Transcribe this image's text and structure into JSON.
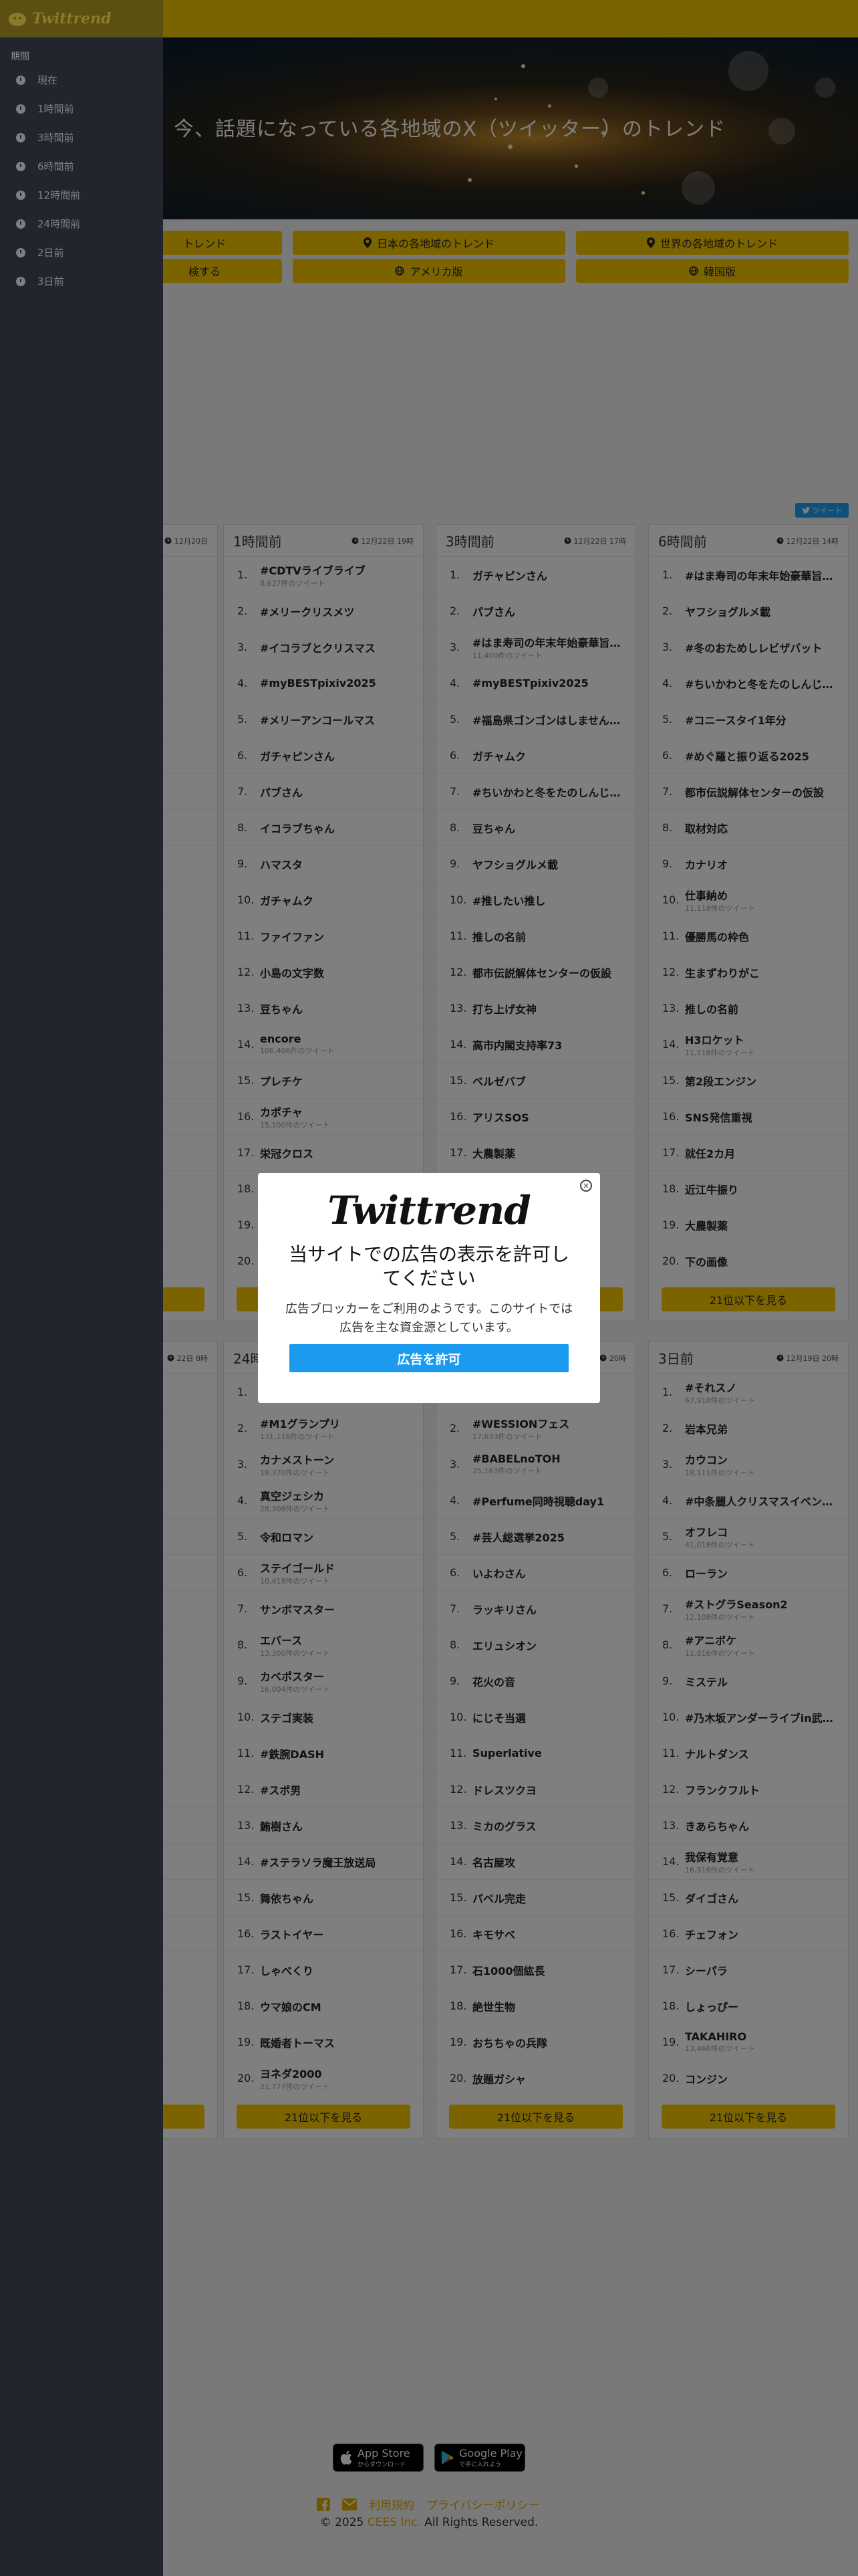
{
  "hero": {
    "title": "今、話題になっている各地域のX（ツイッター）のトレンド"
  },
  "nav": [
    {
      "label": "トレンド",
      "icon": "none"
    },
    {
      "label": "日本の各地域のトレンド",
      "icon": "map-marker-icon"
    },
    {
      "label": "世界の各地域のトレンド",
      "icon": "map-marker-icon"
    },
    {
      "label": "検する",
      "icon": "none"
    },
    {
      "label": "アメリカ版",
      "icon": "globe-icon"
    },
    {
      "label": "韓国版",
      "icon": "globe-icon"
    }
  ],
  "share": {
    "label": "ツイート"
  },
  "cards_top": [
    {
      "title": "",
      "time": "12月20日",
      "partial": true,
      "items": [
        [
          "",
          ""
        ],
        [
          "",
          ""
        ],
        [
          "クス",
          ""
        ],
        [
          "",
          ""
        ],
        [
          "",
          ""
        ],
        [
          "",
          ""
        ],
        [
          "",
          ""
        ],
        [
          "",
          ""
        ],
        [
          "",
          ""
        ],
        [
          "",
          ""
        ],
        [
          "",
          ""
        ],
        [
          "",
          ""
        ],
        [
          "",
          ""
        ],
        [
          "",
          ""
        ],
        [
          "",
          ""
        ],
        [
          "",
          ""
        ],
        [
          "",
          ""
        ],
        [
          "",
          ""
        ],
        [
          "",
          ""
        ],
        [
          "",
          ""
        ]
      ]
    },
    {
      "title": "1時間前",
      "time": "12月22日 19時",
      "items": [
        [
          "#CDTVライブライブ",
          "8,637件のツイート"
        ],
        [
          "#メリークリスメツ",
          ""
        ],
        [
          "#イコラブとクリスマス",
          ""
        ],
        [
          "#myBESTpixiv2025",
          ""
        ],
        [
          "#メリーアンコールマス",
          ""
        ],
        [
          "ガチャピンさん",
          ""
        ],
        [
          "パブさん",
          ""
        ],
        [
          "イコラブちゃん",
          ""
        ],
        [
          "ハマスタ",
          ""
        ],
        [
          "ガチャムク",
          ""
        ],
        [
          "ファイファン",
          ""
        ],
        [
          "小島の文字数",
          ""
        ],
        [
          "豆ちゃん",
          ""
        ],
        [
          "encore",
          "106,406件のツイート"
        ],
        [
          "プレチケ",
          ""
        ],
        [
          "カポチャ",
          "15,100件のツイート"
        ],
        [
          "栄冠クロス",
          ""
        ],
        [
          "",
          ""
        ],
        [
          "",
          ""
        ],
        [
          "",
          ""
        ]
      ]
    },
    {
      "title": "3時間前",
      "time": "12月22日 17時",
      "items": [
        [
          "ガチャピンさん",
          ""
        ],
        [
          "パブさん",
          ""
        ],
        [
          "#はま寿司の年末年始豪華旨ね...",
          "11,400件のツイート"
        ],
        [
          "#myBESTpixiv2025",
          ""
        ],
        [
          "#福島県ゴンゴンはしませんか生...",
          ""
        ],
        [
          "ガチャムク",
          ""
        ],
        [
          "#ちいかわと冬をたのしんじゃお",
          ""
        ],
        [
          "豆ちゃん",
          ""
        ],
        [
          "ヤフショグルメ載",
          ""
        ],
        [
          "#推したい推し",
          ""
        ],
        [
          "推しの名前",
          ""
        ],
        [
          "都市伝説解体センターの仮設",
          ""
        ],
        [
          "打ち上げ女神",
          ""
        ],
        [
          "高市内閣支持率73",
          ""
        ],
        [
          "ベルゼバブ",
          ""
        ],
        [
          "アリスSOS",
          ""
        ],
        [
          "大農製薬",
          ""
        ],
        [
          "",
          ""
        ],
        [
          "",
          ""
        ],
        [
          "",
          ""
        ]
      ]
    },
    {
      "title": "6時間前",
      "time": "12月22日 14時",
      "items": [
        [
          "#はま寿司の年末年始豪華旨ね...",
          ""
        ],
        [
          "ヤフショグルメ載",
          ""
        ],
        [
          "#冬のおためしレビザバット",
          ""
        ],
        [
          "#ちいかわと冬をたのしんじゃお",
          ""
        ],
        [
          "#コニースタイ1年分",
          ""
        ],
        [
          "#めぐ羅と振り返る2025",
          ""
        ],
        [
          "都市伝説解体センターの仮設",
          ""
        ],
        [
          "取材対応",
          ""
        ],
        [
          "カナリオ",
          ""
        ],
        [
          "仕事納め",
          "11,118件のツイート"
        ],
        [
          "優勝馬の枠色",
          ""
        ],
        [
          "生まずわりがこ",
          ""
        ],
        [
          "推しの名前",
          ""
        ],
        [
          "H3ロケット",
          "11,118件のツイート"
        ],
        [
          "第2段エンジン",
          ""
        ],
        [
          "SNS発信重視",
          ""
        ],
        [
          "就任2カ月",
          ""
        ],
        [
          "近江牛振り",
          ""
        ],
        [
          "大農製薬",
          ""
        ],
        [
          "下の画像",
          ""
        ]
      ]
    }
  ],
  "cards_bottom": [
    {
      "title": "",
      "time": "22日 8時",
      "partial": true,
      "items": [
        [
          "",
          ""
        ],
        [
          "",
          ""
        ],
        [
          "",
          ""
        ],
        [
          "",
          ""
        ],
        [
          "",
          ""
        ],
        [
          "",
          ""
        ],
        [
          "",
          ""
        ],
        [
          "",
          ""
        ],
        [
          "",
          ""
        ],
        [
          "",
          ""
        ],
        [
          "",
          ""
        ],
        [
          "",
          ""
        ],
        [
          "",
          ""
        ],
        [
          "",
          ""
        ],
        [
          "",
          ""
        ],
        [
          "",
          ""
        ],
        [
          "",
          ""
        ],
        [
          "",
          ""
        ],
        [
          "",
          ""
        ],
        [
          "",
          ""
        ]
      ]
    },
    {
      "title": "24時間前",
      "time": "",
      "items": [
        [
          "",
          "61,813件のツイート"
        ],
        [
          "#M1グランプリ",
          "131,116件のツイート"
        ],
        [
          "カナメストーン",
          "18,370件のツイート"
        ],
        [
          "真空ジェシカ",
          "28,308件のツイート"
        ],
        [
          "令和ロマン",
          ""
        ],
        [
          "ステイゴールド",
          "10,418件のツイート"
        ],
        [
          "サンボマスター",
          ""
        ],
        [
          "エバース",
          "13,300件のツイート"
        ],
        [
          "カベポスター",
          "16,004件のツイート"
        ],
        [
          "ステゴ実装",
          ""
        ],
        [
          "#鉄腕DASH",
          ""
        ],
        [
          "#スポ男",
          ""
        ],
        [
          "鮪樹さん",
          ""
        ],
        [
          "#ステラソラ魔王放送局",
          ""
        ],
        [
          "舞依ちゃん",
          ""
        ],
        [
          "ラストイヤー",
          ""
        ],
        [
          "しゃべくり",
          ""
        ],
        [
          "ウマ娘のCM",
          ""
        ],
        [
          "既婚者トーマス",
          ""
        ],
        [
          "ヨネダ2000",
          "21,777件のツイート"
        ]
      ]
    },
    {
      "title": "",
      "time": "20時",
      "items": [
        [
          "",
          "12,518件"
        ],
        [
          "#WESSIONフェス",
          "17,633件のツイート"
        ],
        [
          "#BABELnoTOH",
          "25,163件のツイート"
        ],
        [
          "#Perfume同時視聴day1",
          ""
        ],
        [
          "#芸人総選挙2025",
          ""
        ],
        [
          "いよわさん",
          ""
        ],
        [
          "ラッキリさん",
          ""
        ],
        [
          "エリュシオン",
          ""
        ],
        [
          "花火の音",
          ""
        ],
        [
          "にじそ当選",
          ""
        ],
        [
          "Superlative",
          ""
        ],
        [
          "ドレスツクヨ",
          ""
        ],
        [
          "ミカのグラス",
          ""
        ],
        [
          "名古屋攻",
          ""
        ],
        [
          "パベル完走",
          ""
        ],
        [
          "キモサベ",
          ""
        ],
        [
          "石1000個紘長",
          ""
        ],
        [
          "絶世生物",
          ""
        ],
        [
          "おちちゃの兵隊",
          ""
        ],
        [
          "放題ガシャ",
          ""
        ]
      ]
    },
    {
      "title": "3日前",
      "time": "12月19日 20時",
      "items": [
        [
          "#それスノ",
          "67,918件のツイート"
        ],
        [
          "岩本兄弟",
          ""
        ],
        [
          "カウコン",
          "18,111件のツイート"
        ],
        [
          "#中条麗人クリスマスイベント...",
          ""
        ],
        [
          "オフレコ",
          "41,018件のツイート"
        ],
        [
          "ローラン",
          ""
        ],
        [
          "#ストグラSeason2",
          "12,108件のツイート"
        ],
        [
          "#アニボケ",
          "11,816件のツイート"
        ],
        [
          "ミステル",
          ""
        ],
        [
          "#乃木坂アンダーライブin武道...",
          ""
        ],
        [
          "ナルトダンス",
          ""
        ],
        [
          "フランクフルト",
          ""
        ],
        [
          "きあらちゃん",
          ""
        ],
        [
          "我保有覚意",
          "16,916件のツイート"
        ],
        [
          "ダイゴさん",
          ""
        ],
        [
          "チェフォン",
          ""
        ],
        [
          "シーパラ",
          ""
        ],
        [
          "しょっぴー",
          ""
        ],
        [
          "TAKAHIRO",
          "13,466件のツイート"
        ],
        [
          "コンジン",
          ""
        ]
      ]
    }
  ],
  "more_label": "21位以下を見る",
  "sidebar": {
    "brand": "Twittrend",
    "section_label": "期間",
    "items": [
      "現在",
      "1時間前",
      "3時間前",
      "6時間前",
      "12時間前",
      "24時間前",
      "2日前",
      "3日前"
    ]
  },
  "modal": {
    "logo": "Twittrend",
    "title": "当サイトでの広告の表示を許可してください",
    "message": "広告ブロッカーをご利用のようです。このサイトでは広告を主な資金源としています。",
    "button": "広告を許可",
    "close": "×"
  },
  "footer": {
    "appstore_small": "App Store",
    "appstore_big": "からダウンロード",
    "googleplay_small": "Google Play",
    "googleplay_big": "で手に入れよう",
    "terms": "利用規約",
    "privacy": "プライバシーポリシー",
    "copyright_pre": "© 2025 ",
    "company": "CEES Inc.",
    "copyright_post": " All Rights Reserved."
  },
  "colors": {
    "brand_yellow": "#f6c800",
    "overlay": "rgba(0,0,0,0.5)",
    "sidebar": "#22252d",
    "modal_button": "#1a9bf0",
    "twitter": "#1da1f2"
  }
}
